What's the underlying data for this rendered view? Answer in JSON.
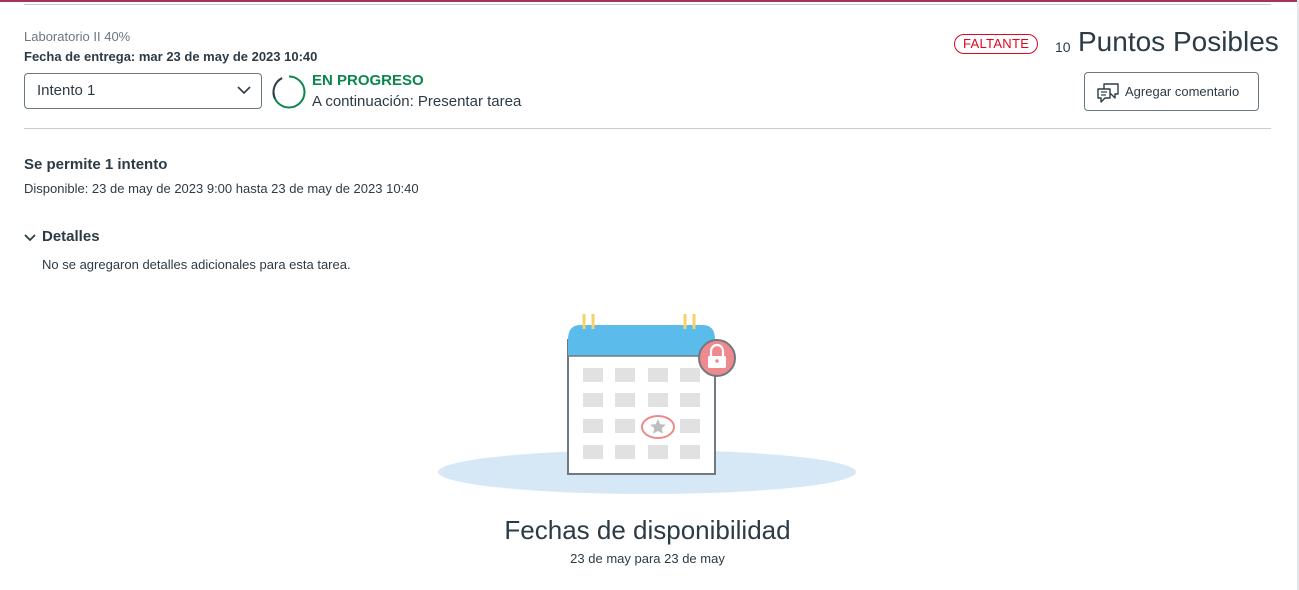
{
  "header": {
    "course": "Laboratorio II 40%",
    "due_date": "Fecha de entrega: mar 23 de may de 2023 10:40",
    "missing_badge": "FALTANTE",
    "points_value": "10",
    "points_label": "Puntos Posibles",
    "add_comment": "Agregar comentario"
  },
  "attempt": {
    "selected": "Intento 1",
    "status": "EN PROGRESO",
    "next_step": "A continuación: Presentar tarea"
  },
  "info": {
    "attempts_allowed": "Se permite 1 intento",
    "availability": "Disponible: 23 de may de 2023 9:00 hasta 23 de may de 2023 10:40"
  },
  "details": {
    "toggle_label": "Detalles",
    "text": "No se agregaron detalles adicionales para esta tarea."
  },
  "empty_state": {
    "title": "Fechas de disponibilidad",
    "subtitle": "23 de may para 23 de may"
  },
  "icons": {
    "select_chevron": "chevron-down-icon",
    "progress": "progress-ring-icon",
    "comment": "comment-icon",
    "details_chevron": "chevron-down-icon",
    "illustration": "locked-calendar-icon"
  },
  "colors": {
    "brand_bar": "#a03557",
    "status_green": "#0b874b",
    "missing_red": "#e0061f",
    "calendar_blue": "#5bbbea",
    "lock_red": "#ee8a8f"
  }
}
